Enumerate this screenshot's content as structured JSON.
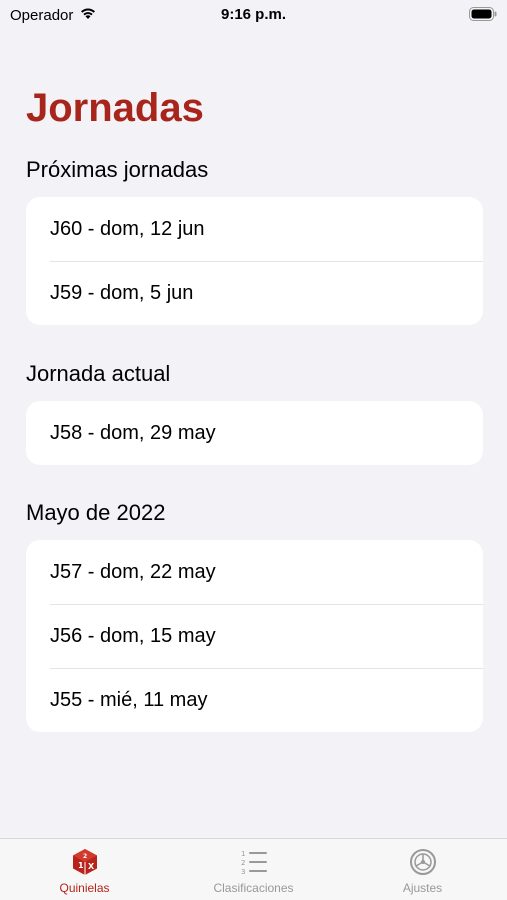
{
  "status_bar": {
    "carrier": "Operador",
    "time": "9:16 p.m."
  },
  "page": {
    "title": "Jornadas"
  },
  "sections": [
    {
      "header": "Próximas jornadas",
      "items": [
        "J60 - dom, 12 jun",
        "J59 - dom, 5 jun"
      ]
    },
    {
      "header": "Jornada actual",
      "items": [
        "J58 - dom, 29 may"
      ]
    },
    {
      "header": "Mayo de 2022",
      "items": [
        "J57 - dom, 22 may",
        "J56 - dom, 15 may",
        "J55 - mié, 11 may"
      ]
    }
  ],
  "tab_bar": {
    "tabs": [
      {
        "label": "Quinielas",
        "icon": "dice-cube-icon",
        "active": true
      },
      {
        "label": "Clasificaciones",
        "icon": "numbered-list-icon",
        "active": false
      },
      {
        "label": "Ajustes",
        "icon": "gear-icon",
        "active": false
      }
    ]
  },
  "colors": {
    "accent": "#a8251b",
    "background": "#f2f2f7",
    "card": "#ffffff",
    "tab_inactive": "#999999"
  }
}
